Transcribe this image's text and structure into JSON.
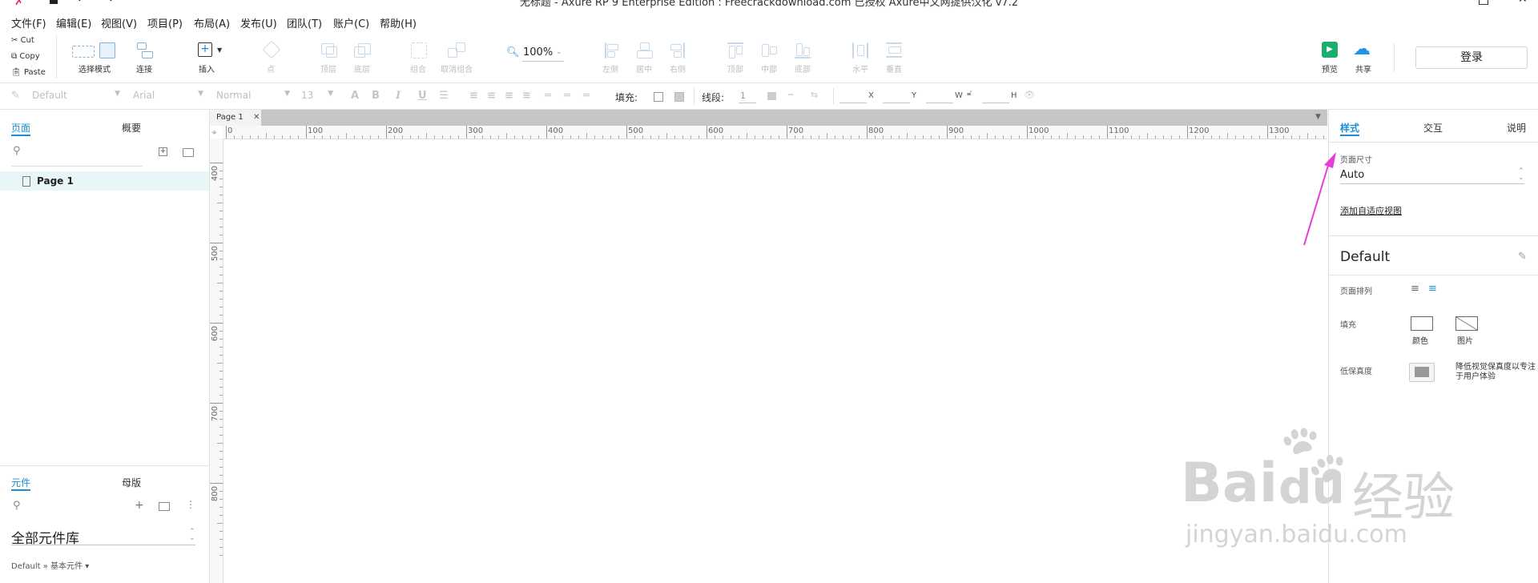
{
  "window": {
    "title": "无标题 - Axure RP 9 Enterprise Edition : Freecrackdownload.com 已授权    Axure中文网提供汉化 v7.2"
  },
  "menu": [
    "文件(F)",
    "编辑(E)",
    "视图(V)",
    "项目(P)",
    "布局(A)",
    "发布(U)",
    "团队(T)",
    "账户(C)",
    "帮助(H)"
  ],
  "clipboard": {
    "cut": "Cut",
    "copy": "Copy",
    "paste": "Paste"
  },
  "toolbar": {
    "select_mode": "选择模式",
    "connect": "连接",
    "insert": "插入",
    "point": "点",
    "top": "顶层",
    "bottom": "底层",
    "group": "组合",
    "ungroup": "取消组合",
    "zoom": "100%",
    "align_left": "左侧",
    "align_center": "居中",
    "align_right": "右侧",
    "align_top": "顶部",
    "align_middle": "中部",
    "align_bottom": "底部",
    "dist_horizontal": "水平",
    "dist_vertical": "垂直",
    "preview": "预览",
    "share": "共享",
    "login": "登录"
  },
  "format_bar": {
    "style": "Default",
    "font": "Arial",
    "weight": "Normal",
    "size": "13",
    "fill_label": "填充:",
    "stroke_label": "线段:",
    "stroke_value": "1",
    "x": "X",
    "y": "Y",
    "w": "W",
    "h": "H"
  },
  "pages_panel": {
    "tabs": [
      "页面",
      "概要"
    ],
    "pages": [
      "Page 1"
    ]
  },
  "library_panel": {
    "tabs": [
      "元件",
      "母版"
    ],
    "library": "全部元件库",
    "breadcrumb": "Default » 基本元件 ▾"
  },
  "canvas": {
    "tab": "Page 1",
    "hruler_labels": [
      "0",
      "100",
      "200",
      "300",
      "400",
      "500",
      "600",
      "700",
      "800",
      "900",
      "1000",
      "1100",
      "1200",
      "1300"
    ],
    "vruler_labels": [
      "400",
      "500",
      "600",
      "700",
      "800"
    ]
  },
  "inspector": {
    "tabs": [
      "样式",
      "交互",
      "说明"
    ],
    "page_size_label": "页面尺寸",
    "page_size_value": "Auto",
    "adaptive_link": "添加自适应视图",
    "style_name": "Default",
    "page_align_label": "页面排列",
    "fill_label": "填充",
    "fill_color": "颜色",
    "fill_image": "图片",
    "low_fidelity_label": "低保真度",
    "low_fidelity_desc": "降低视觉保真度以专注于用户体验"
  },
  "watermark": {
    "brand": "Bai",
    "brand2": "du",
    "cn": "经验",
    "url": "jingyan.baidu.com"
  },
  "colors": {
    "accent": "#1a8fd6",
    "arrow": "#e83cd8",
    "preview": "#1aae6f",
    "share": "#1e96e6"
  }
}
